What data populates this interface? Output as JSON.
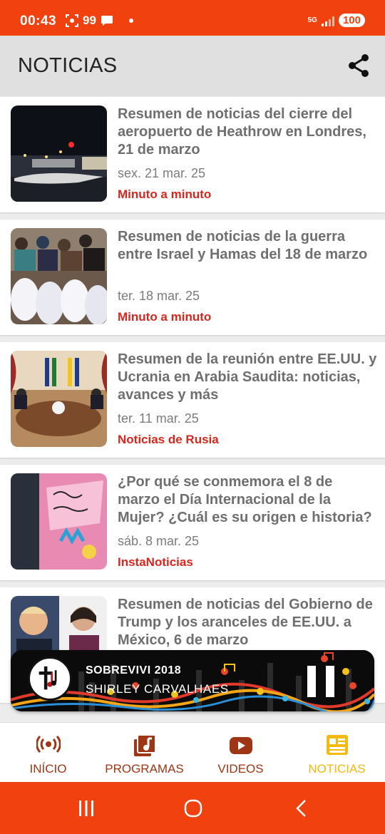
{
  "status_bar": {
    "time": "00:43",
    "notification_count": "99",
    "network": "5G",
    "battery": "100"
  },
  "header": {
    "title": "NOTICIAS",
    "share_icon": "share-icon"
  },
  "news": [
    {
      "title": "Resumen de noticias del cierre del aeropuerto de Heathrow en Londres, 21 de marzo",
      "date": "sex. 21 mar. 25",
      "category": "Minuto a minuto"
    },
    {
      "title": "Resumen de noticias de la guerra entre Israel y Hamas del 18 de marzo",
      "date": "ter. 18 mar. 25",
      "category": "Minuto a minuto"
    },
    {
      "title": "Resumen de la reunión entre EE.UU. y Ucrania en Arabia Saudita: noticias, avances y más",
      "date": "ter. 11 mar. 25",
      "category": "Noticias de Rusia"
    },
    {
      "title": "¿Por qué se conmemora el 8 de marzo el Día Internacional de la Mujer? ¿Cuál es su origen e historia?",
      "date": "sáb. 8 mar. 25",
      "category": "InstaNoticias"
    },
    {
      "title": "Resumen de noticias del Gobierno de Trump y los aranceles de EE.UU. a México, 6 de marzo",
      "date": "",
      "category": ""
    }
  ],
  "player": {
    "title": "SOBREVIVI 2018",
    "artist": "SHIRLEY CARVALHAES",
    "state": "playing"
  },
  "nav": {
    "items": [
      {
        "label": "INÍCIO",
        "icon": "radio-broadcast-icon"
      },
      {
        "label": "PROGRAMAS",
        "icon": "music-library-icon"
      },
      {
        "label": "VIDEOS",
        "icon": "youtube-play-icon"
      },
      {
        "label": "NOTICIAS",
        "icon": "newspaper-icon"
      }
    ],
    "active": "NOTICIAS"
  },
  "colors": {
    "brand": "#f1410f",
    "category_red": "#d8261c",
    "nav_inactive": "#9e3514",
    "nav_active": "#f4ba10"
  }
}
